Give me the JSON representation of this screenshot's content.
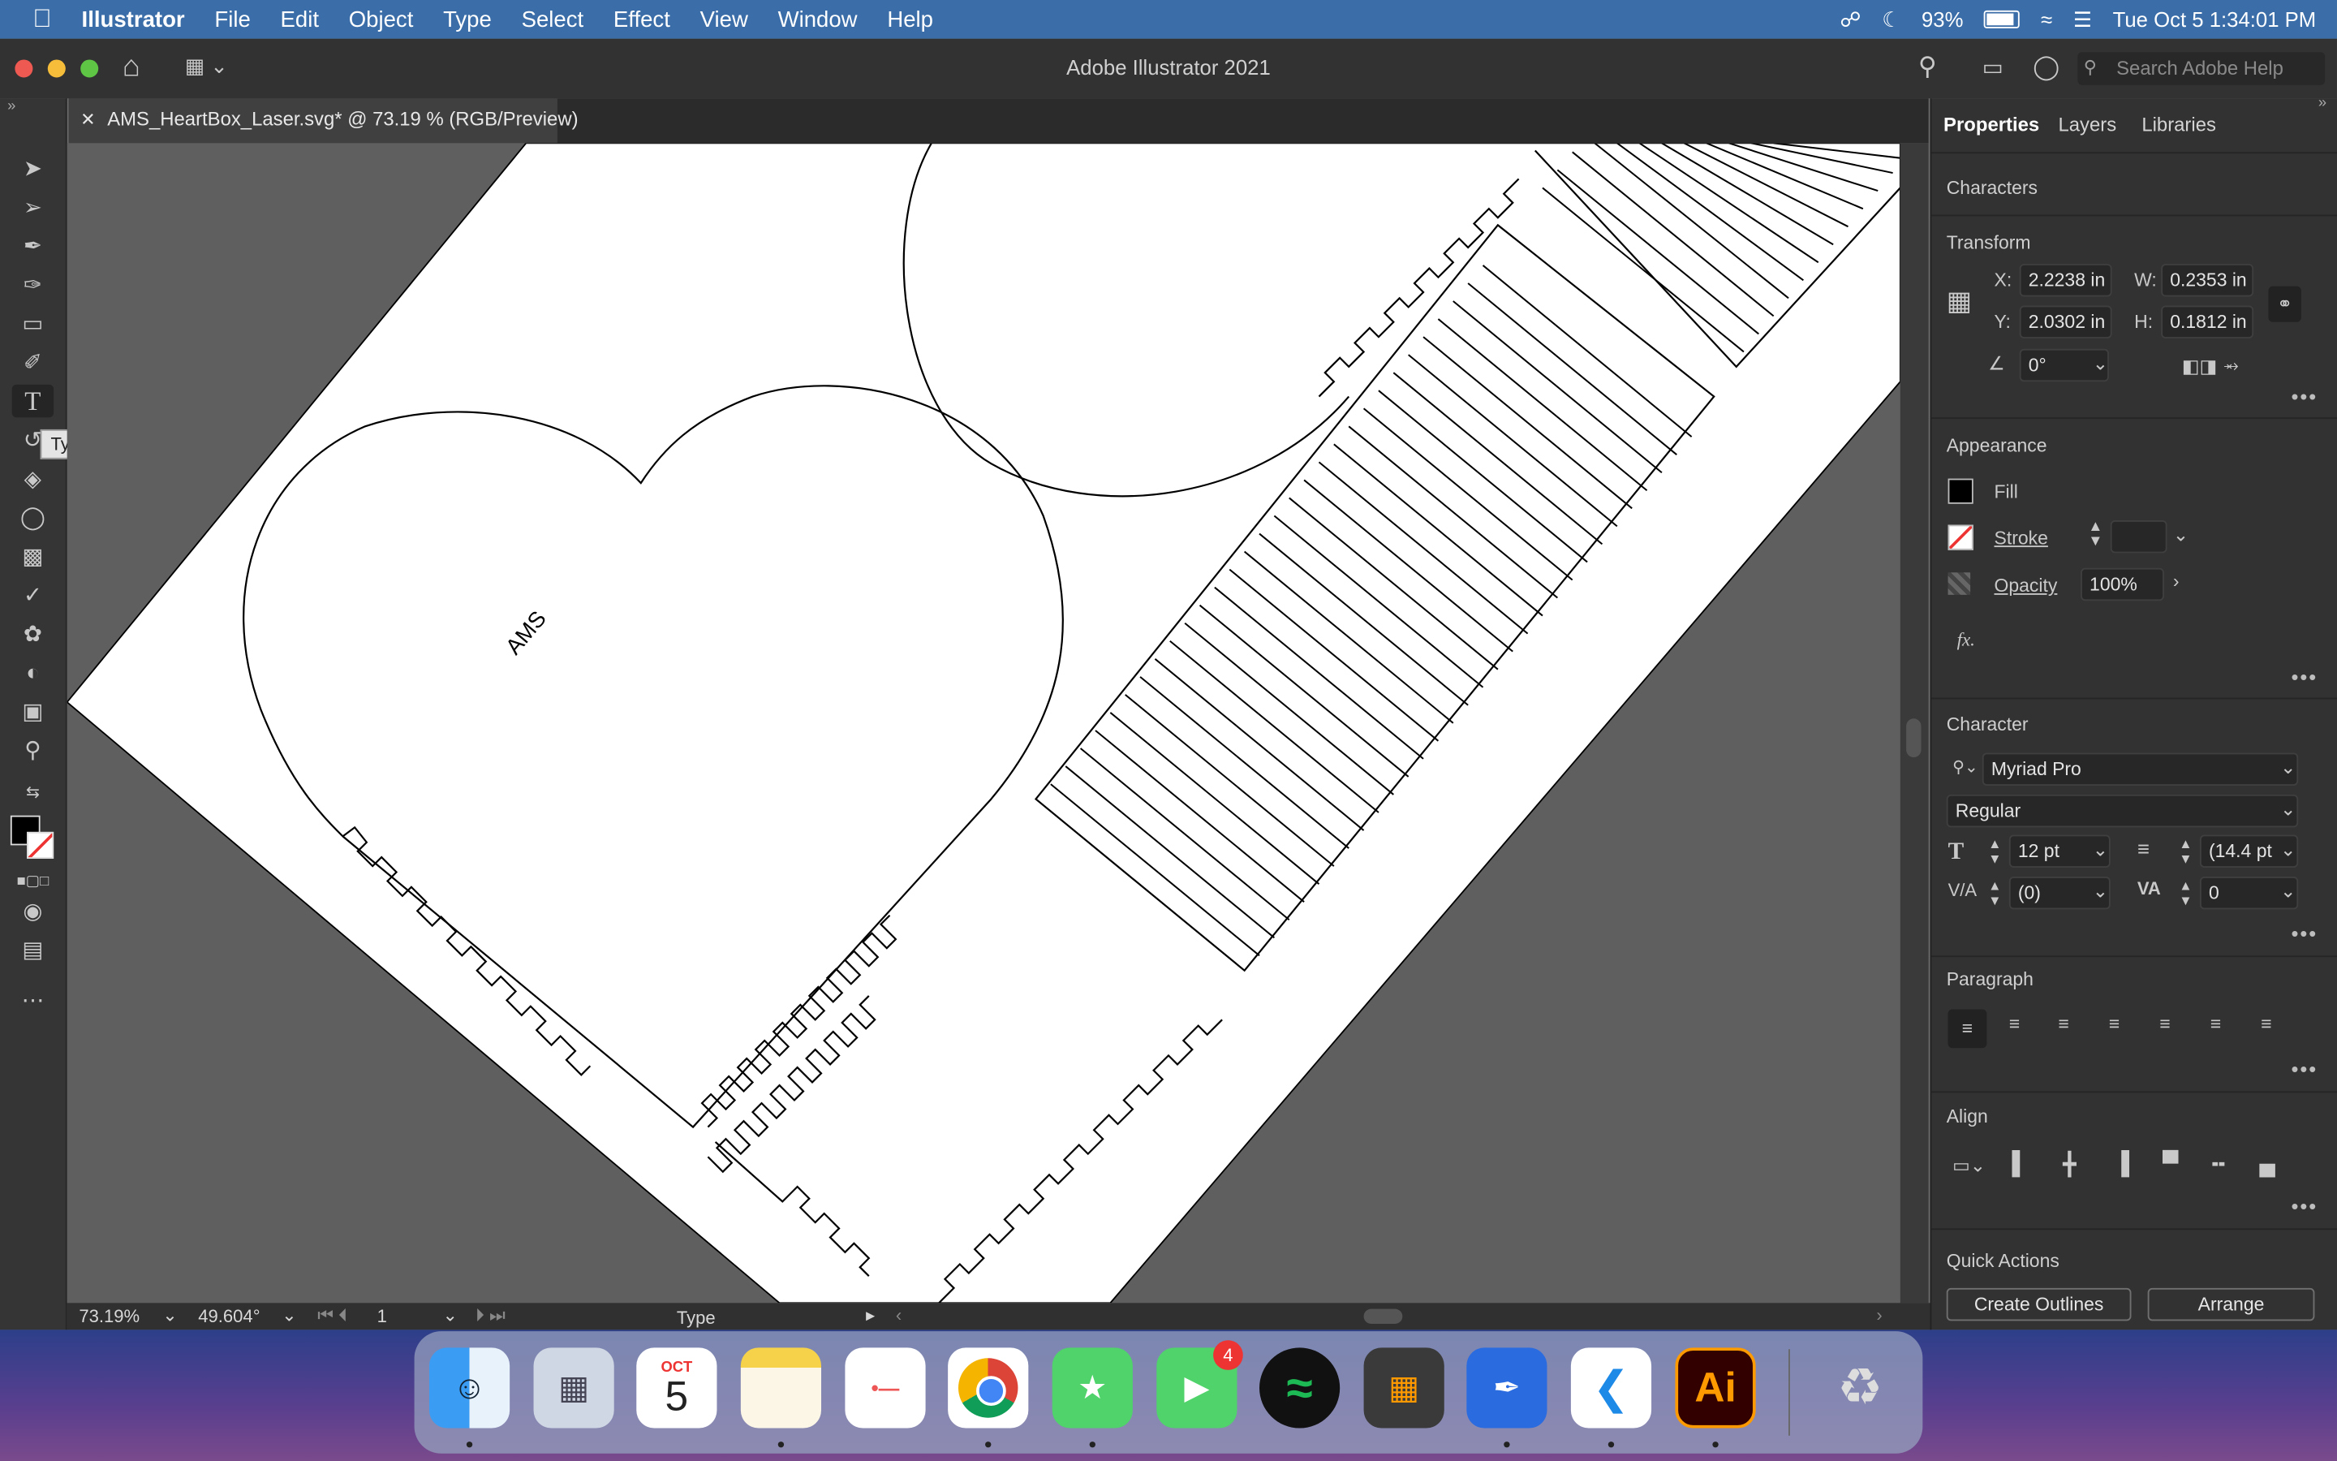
{
  "menubar": {
    "apple": "",
    "app_name": "Illustrator",
    "items": [
      "File",
      "Edit",
      "Object",
      "Type",
      "Select",
      "Effect",
      "View",
      "Window",
      "Help"
    ],
    "battery": "93%",
    "clock": "Tue Oct 5  1:34:01 PM"
  },
  "window": {
    "title": "Adobe Illustrator 2021",
    "search_placeholder": "Search Adobe Help"
  },
  "document": {
    "tab_label": "AMS_HeartBox_Laser.svg* @ 73.19 % (RGB/Preview)",
    "canvas_text": "AMS"
  },
  "toolbar": {
    "tooltip": "Type Tool (T)"
  },
  "statusbar": {
    "zoom": "73.19%",
    "angle": "49.604°",
    "artboard": "1",
    "tool": "Type"
  },
  "panel": {
    "tabs": [
      "Properties",
      "Layers",
      "Libraries"
    ],
    "characters_label": "Characters",
    "transform": {
      "title": "Transform",
      "x_label": "X:",
      "x": "2.2238 in",
      "y_label": "Y:",
      "y": "2.0302 in",
      "w_label": "W:",
      "w": "0.2353 in",
      "h_label": "H:",
      "h": "0.1812 in",
      "rotate": "0°"
    },
    "appearance": {
      "title": "Appearance",
      "fill": "Fill",
      "stroke": "Stroke",
      "opacity_label": "Opacity",
      "opacity": "100%",
      "fx": "fx."
    },
    "character": {
      "title": "Character",
      "font": "Myriad Pro",
      "style": "Regular",
      "size": "12 pt",
      "leading": "(14.4 pt",
      "kerning": "(0)",
      "tracking": "0"
    },
    "paragraph": {
      "title": "Paragraph"
    },
    "align": {
      "title": "Align"
    },
    "quick_actions": {
      "title": "Quick Actions",
      "create_outlines": "Create Outlines",
      "arrange": "Arrange"
    }
  },
  "dock": {
    "calendar_month": "OCT",
    "calendar_day": "5",
    "facetime_badge": "4",
    "illustrator": "Ai"
  },
  "colors": {
    "menubar": "#3b6ea8",
    "ui_dark": "#323232",
    "canvas_bg": "#5f5f5f",
    "artboard": "#ffffff"
  }
}
